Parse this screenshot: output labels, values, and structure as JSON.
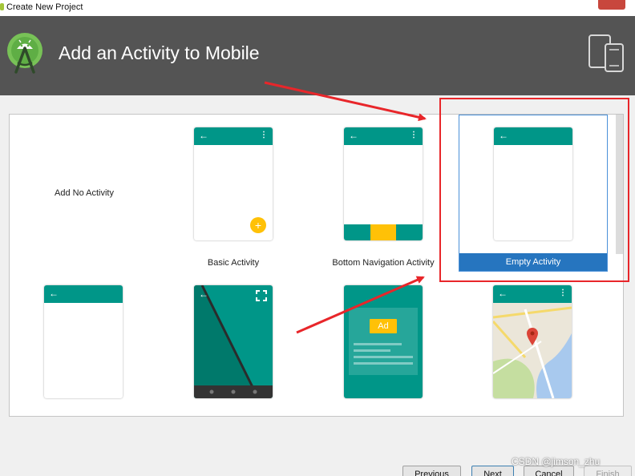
{
  "window": {
    "title": "Create New Project"
  },
  "header": {
    "title": "Add an Activity to Mobile",
    "logo_icon": "android-studio-logo-icon",
    "devices_icon": "phone-tablet-icon"
  },
  "colors": {
    "header_bg": "#545454",
    "teal": "#009688",
    "accent_yellow": "#ffc107",
    "selection_blue": "#2675bf",
    "annotation_red": "#e8262a"
  },
  "activities": {
    "no_activity": {
      "label": "Add No Activity"
    },
    "basic": {
      "label": "Basic Activity"
    },
    "bottom_nav": {
      "label": "Bottom Navigation Activity"
    },
    "empty": {
      "label": "Empty Activity",
      "selected": true
    },
    "ad": {
      "badge": "Ad"
    }
  },
  "glyphs": {
    "back": "←",
    "menu": "⋮",
    "plus": "+"
  },
  "buttons": {
    "previous": "Previous",
    "next": "Next",
    "cancel": "Cancel",
    "finish": "Finish"
  },
  "watermark": "CSDN @jimson_zhu"
}
